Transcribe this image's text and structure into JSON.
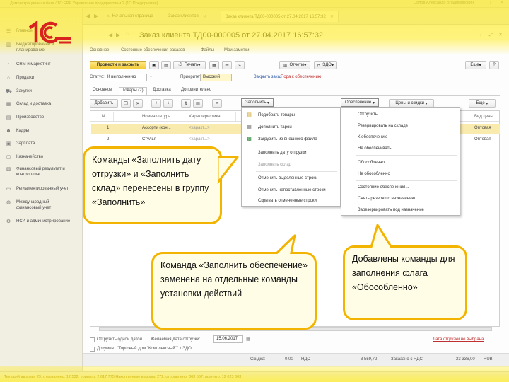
{
  "window": {
    "title": "Демонстрационная база / 1С:ERP Управление предприятием 2  (1С:Предприятие)",
    "user": "Орлов Александр Владимирович",
    "controls": "_ ▢ ✕"
  },
  "sidebar": {
    "items": [
      {
        "label": "Главное",
        "icon": "menu-icon"
      },
      {
        "label": "Бюджетирование и планирование",
        "icon": "chart-icon"
      },
      {
        "label": "CRM и маркетинг",
        "icon": "crm-icon"
      },
      {
        "label": "Продажи",
        "icon": "sales-icon"
      },
      {
        "label": "Закупки",
        "icon": "cart-icon"
      },
      {
        "label": "Склад и доставка",
        "icon": "warehouse-icon"
      },
      {
        "label": "Производство",
        "icon": "factory-icon"
      },
      {
        "label": "Кадры",
        "icon": "people-icon"
      },
      {
        "label": "Зарплата",
        "icon": "salary-icon"
      },
      {
        "label": "Казначейство",
        "icon": "treasury-icon"
      },
      {
        "label": "Финансовый результат и контроллинг",
        "icon": "finance-icon"
      },
      {
        "label": "Регламентированный учет",
        "icon": "report-icon"
      },
      {
        "label": "Международный финансовый учет",
        "icon": "globe-icon"
      },
      {
        "label": "НСИ и администрирование",
        "icon": "gear-icon"
      }
    ]
  },
  "tabs": [
    {
      "label": "Начальная страница",
      "closable": false
    },
    {
      "label": "Заказ клиентов",
      "closable": true
    },
    {
      "label": "Заказ клиента ТД00-000005 от 27.04.2017 16:57:32",
      "closable": true
    }
  ],
  "document": {
    "title": "Заказ клиента ТД00-000005 от 27.04.2017 16:57:32",
    "subtabs": [
      "Основное",
      "Состояние обеспечения заказов",
      "Файлы",
      "Мои заметки"
    ]
  },
  "toolbar": {
    "post_close": "Провести и закрыть",
    "print": "Печать",
    "reports": "Отчеты",
    "edo": "ЭДО",
    "more": "Еще",
    "help": "?"
  },
  "status_row": {
    "status_label": "Статус:",
    "status_value": "К выполнению",
    "priority_label": "Приоритет:",
    "priority_value": "Высокий",
    "close_order": "Закрыть заказ",
    "on_provision": "Пора к обеспечению"
  },
  "inner_tabs": [
    "Основное",
    "Товары (2)",
    "Доставка",
    "Дополнительно"
  ],
  "table_toolbar": {
    "add": "Добавить",
    "fill": "Заполнить",
    "provision": "Обеспечение",
    "prices": "Цены и скидки",
    "more": "Еще"
  },
  "table": {
    "columns": [
      "N",
      "Номенклатура",
      "Характеристика",
      "Вид цены"
    ],
    "rows": [
      {
        "n": "1",
        "item": "Ассорти (кон...",
        "char": "<характ...>",
        "price_type": "Оптовая"
      },
      {
        "n": "2",
        "item": "Стулья",
        "char": "<характ...>",
        "price_type": "Оптовая"
      }
    ]
  },
  "fill_menu": {
    "items": [
      {
        "label": "Подобрать товары",
        "icon": "pick-icon",
        "disabled": false
      },
      {
        "label": "Дополнить тарой",
        "icon": "box-icon",
        "disabled": false
      },
      {
        "label": "Загрузить из внешнего файла",
        "icon": "excel-icon",
        "disabled": false
      },
      {
        "label": "Заполнить дату отгрузки",
        "icon": "",
        "disabled": false
      },
      {
        "label": "Заполнить склад",
        "icon": "",
        "disabled": true
      },
      {
        "label": "Отменить выделенные строки",
        "icon": "",
        "disabled": false
      },
      {
        "label": "Отменить непоставленные строки",
        "icon": "",
        "disabled": false
      },
      {
        "label": "Скрывать отмененные строки",
        "icon": "",
        "disabled": false
      }
    ]
  },
  "provision_menu": {
    "items": [
      "Отгрузить",
      "Резервировать на складе",
      "К обеспечению",
      "Не обеспечивать",
      "Обособленно",
      "Не обособленно",
      "Состояние обеспечения...",
      "Снять резерв по назначению",
      "Зарезервировать под назначение"
    ]
  },
  "footer": {
    "ship_one_date": "Отгрузить одной датой",
    "desired_date_label": "Желаемая дата отгрузки:",
    "desired_date": "15.06.2017",
    "price_link_prefix": "Документ \"Торговый дом \"Комплексный\"\" к ЭДО",
    "cancelled_link": "Дата отгрузки не выбрана",
    "discount_label": "Скидка:",
    "discount_value": "0,00",
    "vat_label": "НДС",
    "vat_value": "3 559,72",
    "total_label": "Заказано с НДС",
    "total_value": "23 336,00",
    "currency": "RUB"
  },
  "statusbar": {
    "text": "Текущий вызовы: 29, отправлено: 12 532, принято: 2 617 775   Накопленные вызовы: 272, отправлено: 663 567, принято: 12 023 663"
  },
  "callouts": {
    "fill": "Команды «Заполнить дату отгрузки» и «Заполнить склад» перенесены в группу «Заполнить»",
    "provision": "Команда «Заполнить обеспечение» заменена на отдельные команды установки действий",
    "flag": "Добавлены команды для заполнения флага «Обособленно»"
  },
  "colors": {
    "highlight": "#ffec28",
    "callout_border": "#f2b400",
    "callout_bg": "#fffde6",
    "logo_red": "#d8231f",
    "logo_yellow": "#ffcc00"
  }
}
